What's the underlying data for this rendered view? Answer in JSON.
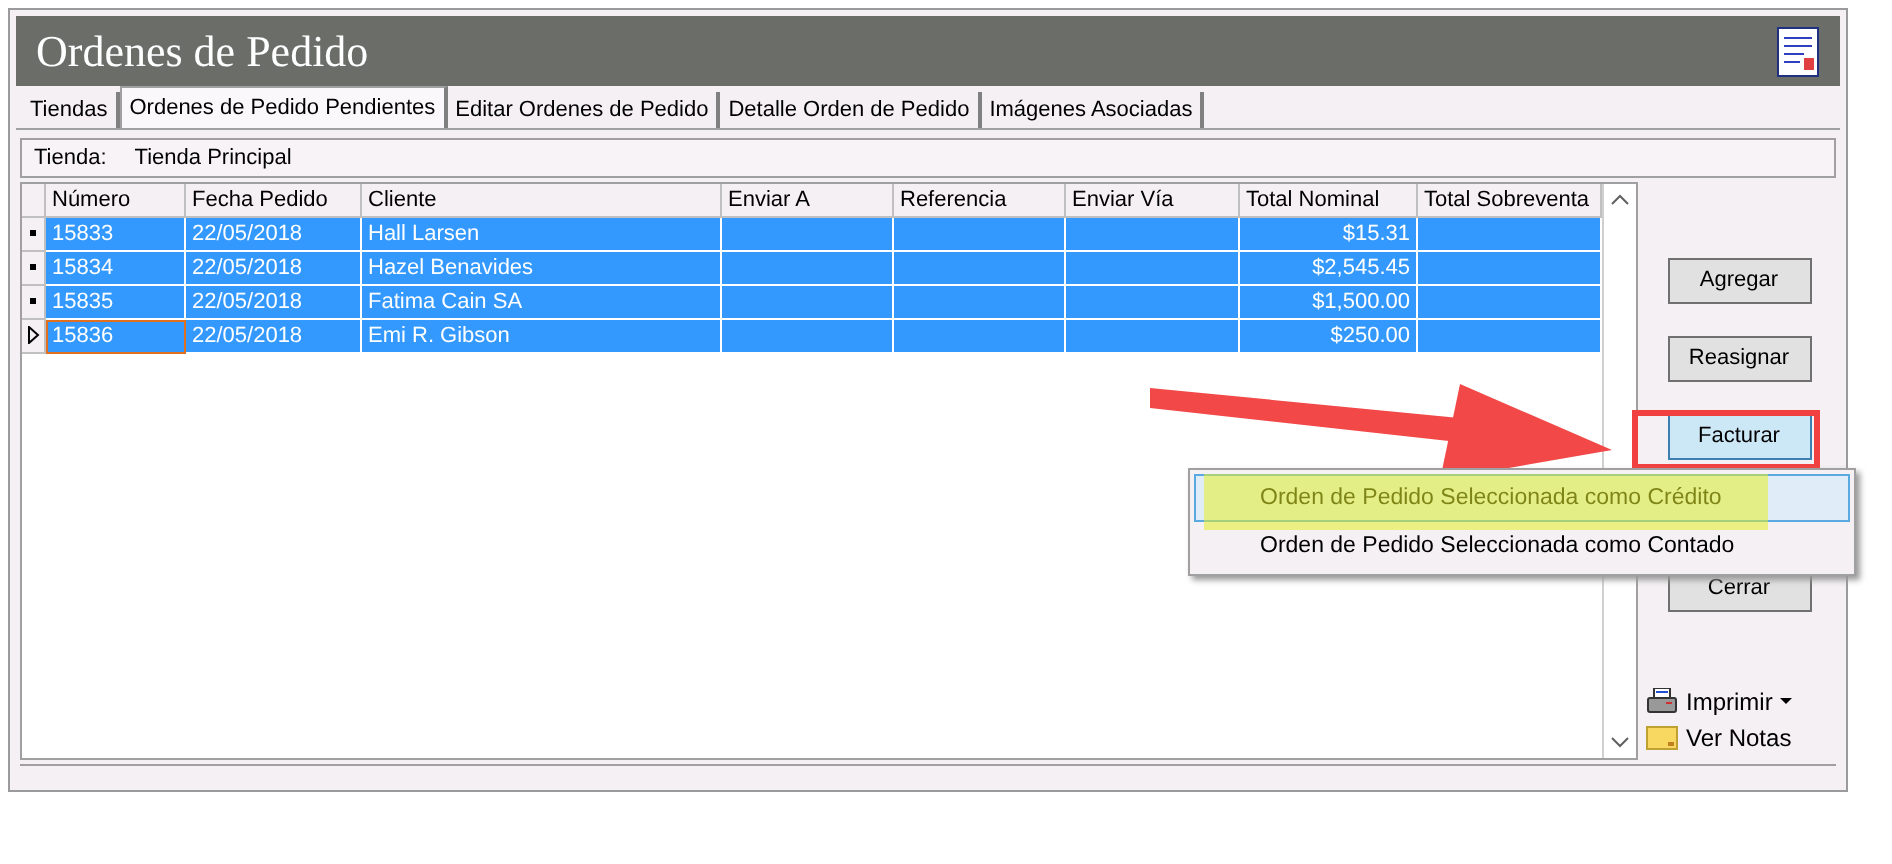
{
  "window": {
    "title": "Ordenes de Pedido"
  },
  "tabs": [
    {
      "label": "Tiendas",
      "selected": false
    },
    {
      "label": "Ordenes de Pedido Pendientes",
      "selected": true
    },
    {
      "label": "Editar Ordenes de Pedido",
      "selected": false
    },
    {
      "label": "Detalle Orden de Pedido",
      "selected": false
    },
    {
      "label": "Imágenes Asociadas",
      "selected": false
    }
  ],
  "store": {
    "label": "Tienda:",
    "value": "Tienda Principal"
  },
  "table": {
    "columns": [
      "Número",
      "Fecha Pedido",
      "Cliente",
      "Enviar A",
      "Referencia",
      "Enviar Vía",
      "Total Nominal",
      "Total Sobreventa"
    ],
    "rows": [
      {
        "cells": [
          "15833",
          "22/05/2018",
          "Hall Larsen",
          "",
          "",
          "",
          "$15.31",
          ""
        ],
        "selected": true,
        "current": false
      },
      {
        "cells": [
          "15834",
          "22/05/2018",
          "Hazel Benavides",
          "",
          "",
          "",
          "$2,545.45",
          ""
        ],
        "selected": true,
        "current": false
      },
      {
        "cells": [
          "15835",
          "22/05/2018",
          "Fatima Cain SA",
          "",
          "",
          "",
          "$1,500.00",
          ""
        ],
        "selected": true,
        "current": false
      },
      {
        "cells": [
          "15836",
          "22/05/2018",
          "Emi R. Gibson",
          "",
          "",
          "",
          "$250.00",
          ""
        ],
        "selected": true,
        "current": true
      }
    ]
  },
  "buttons": [
    {
      "label": "Agregar",
      "pressed": false
    },
    {
      "label": "Reasignar",
      "pressed": false
    },
    {
      "label": "Facturar",
      "pressed": true
    },
    {
      "label": "Cerrar",
      "pressed": false
    }
  ],
  "context_menu": [
    {
      "label": "Orden de Pedido Seleccionada como Crédito",
      "selected": true
    },
    {
      "label": "Orden de Pedido Seleccionada como Contado",
      "selected": false
    }
  ],
  "tools": [
    {
      "kind": "print",
      "label": "Imprimir"
    },
    {
      "kind": "notes",
      "label": "Ver Notas"
    }
  ]
}
